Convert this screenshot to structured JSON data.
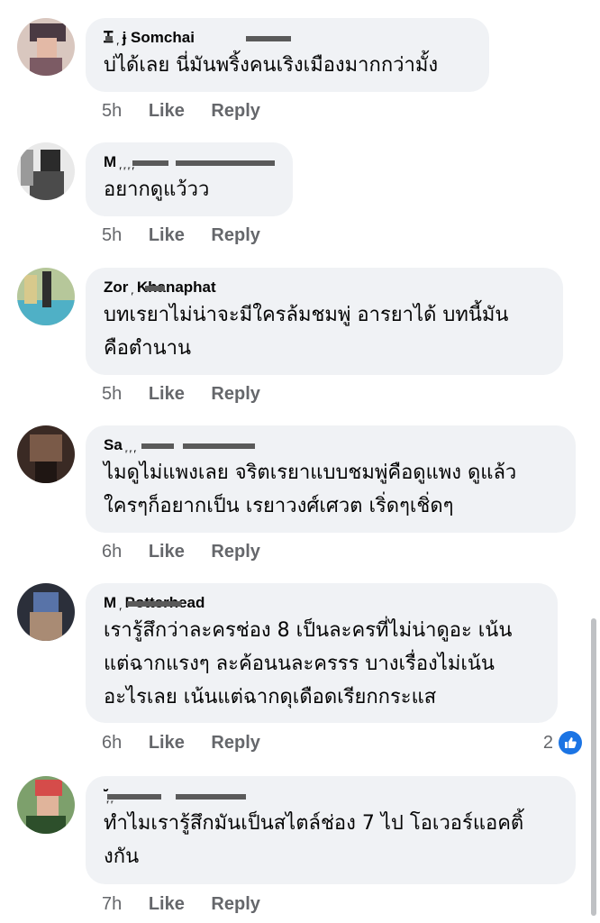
{
  "comments": [
    {
      "name": "Ꮖ ᷊ ɉ Somchai",
      "text": "บ่ได้เลย นี่มันพริ้งคนเริงเมืองมากกว่ามั้ง",
      "time": "5h",
      "like": "Like",
      "reply": "Reply"
    },
    {
      "name": "M ᷊ ᷊ ᷊ ᷊",
      "text": "อยากดูแว้วว",
      "time": "5h",
      "like": "Like",
      "reply": "Reply"
    },
    {
      "name": "Zor ᷊ Khanaphat",
      "text": "บทเรยาไม่น่าจะมีใครล้มชมพู่ อารยาได้ บทนี้มัน\nคือตำนาน",
      "time": "5h",
      "like": "Like",
      "reply": "Reply"
    },
    {
      "name": "Sa ᷊ ᷊ ᷊",
      "text": "ไมดูไม่แพงเลย จริตเรยาแบบชมพู่คือดูแพง ดูแล้ว\nใครๆก็อยากเป็น เรยาวงศ์เศวต เริ่ดๆเชิ่ดๆ",
      "time": "6h",
      "like": "Like",
      "reply": "Reply"
    },
    {
      "name": "M ᷊ Potterhead",
      "text": "เรารู้สึกว่าละครช่อง 8 เป็นละครที่ไม่น่าดูอะ เน้น\nแต่ฉากแรงๆ ละค้อนนละครรร บางเรื่องไม่เน้น\nอะไรเลย เน้นแต่ฉากดุเดือดเรียกกระแส",
      "time": "6h",
      "like": "Like",
      "reply": "Reply",
      "reaction_count": "2"
    },
    {
      "name": "ᷓ ᷊ ᷊",
      "text": "ทำไมเรารู้สึกมันเป็นสไตล์ช่อง 7 ไป โอเวอร์แอคติ้\nงกัน",
      "time": "7h",
      "like": "Like",
      "reply": "Reply"
    }
  ]
}
